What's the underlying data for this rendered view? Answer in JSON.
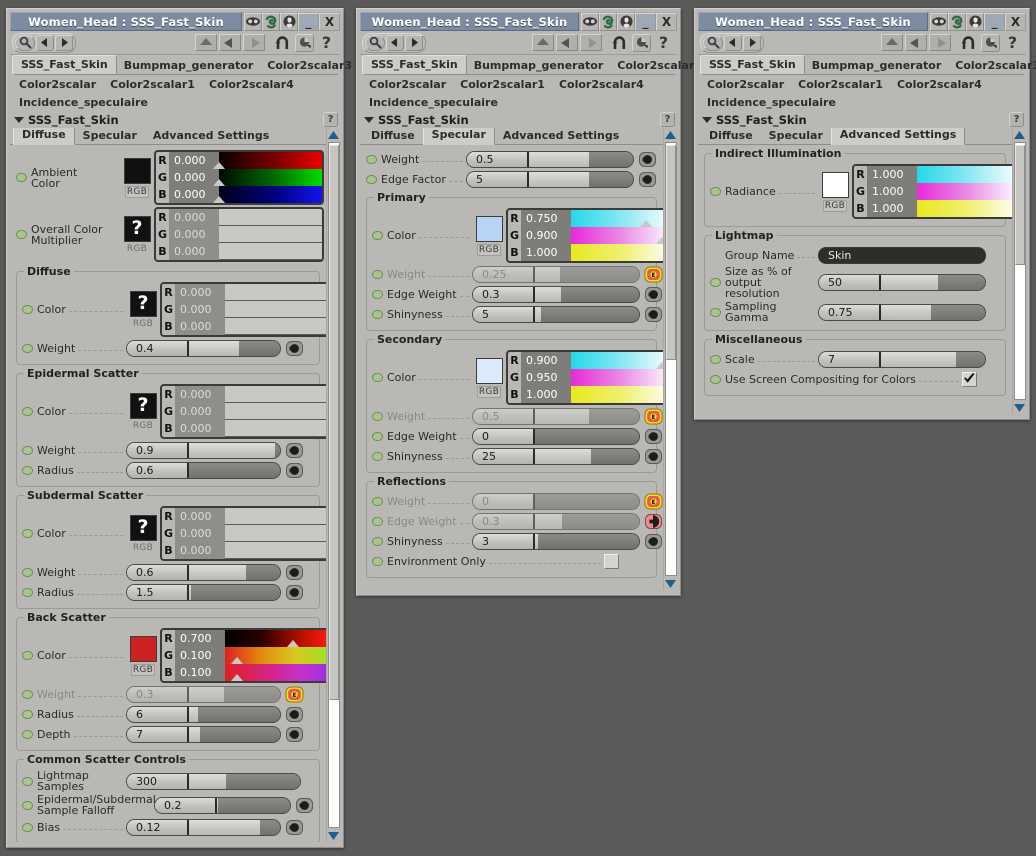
{
  "window": {
    "title": "Women_Head : SSS_Fast_Skin",
    "minimize_label": "_",
    "close_label": "X",
    "icons": [
      "goggles-icon",
      "spiral-icon",
      "face-icon"
    ],
    "toolbar": {
      "magnifier": "magnifier-icon",
      "prev": "prev-arrow-icon",
      "next": "next-arrow-icon",
      "nav_up": "nav-up-icon",
      "nav_left": "nav-left-icon",
      "nav_right": "nav-right-icon",
      "undo": "undo-arrow-icon",
      "render": "render-preview-icon",
      "help": "?"
    }
  },
  "node_tabs": {
    "row1": [
      "SSS_Fast_Skin",
      "Bumpmap_generator",
      "Color2scalar3"
    ],
    "row2": [
      "Color2scalar",
      "Color2scalar1",
      "Color2scalar4"
    ],
    "row3": [
      "Incidence_speculaire"
    ],
    "selected": "SSS_Fast_Skin"
  },
  "shader_header": {
    "title": "SSS_Fast_Skin",
    "help_label": "?"
  },
  "sub_tabs": [
    "Diffuse",
    "Specular",
    "Advanced Settings"
  ],
  "labels": {
    "rgb": "RGB",
    "r": "R",
    "g": "G",
    "b": "B",
    "question": "?"
  },
  "panel1": {
    "selected_tab": "Diffuse",
    "rows": [
      {
        "name": "ambient-color",
        "label_lines": [
          "Ambient",
          "Color"
        ],
        "type": "color",
        "swatch": "#101010",
        "swatch_kind": "solid",
        "rgb_active": true,
        "r": "0.000",
        "g": "0.000",
        "b": "0.000",
        "gradients": [
          "r-dark",
          "g-dark",
          "b-dark"
        ],
        "markers": [
          0,
          0,
          0
        ],
        "plug": "gray"
      },
      {
        "name": "overall-color-multiplier",
        "label_lines": [
          "Overall Color",
          "Multiplier"
        ],
        "type": "color",
        "swatch_kind": "question",
        "rgb_active": false,
        "r": "0.000",
        "g": "0.000",
        "b": "0.000",
        "gradients": [
          "flat",
          "flat",
          "flat"
        ],
        "plug": "red"
      }
    ],
    "groups": [
      {
        "name": "diffuse",
        "title": "Diffuse",
        "rows": [
          {
            "name": "diffuse-color",
            "label_lines": [
              "Color"
            ],
            "type": "color",
            "swatch_kind": "question",
            "rgb_active": false,
            "r": "0.000",
            "g": "0.000",
            "b": "0.000",
            "gradients": [
              "flat",
              "flat",
              "flat"
            ],
            "plug": "red"
          },
          {
            "name": "diffuse-weight",
            "label": "Weight",
            "type": "slider",
            "value": "0.4",
            "fill": 55,
            "plug": "gray"
          }
        ]
      },
      {
        "name": "epidermal-scatter",
        "title": "Epidermal Scatter",
        "rows": [
          {
            "name": "epidermal-color",
            "label_lines": [
              "Color"
            ],
            "type": "color",
            "swatch_kind": "question",
            "rgb_active": false,
            "r": "0.000",
            "g": "0.000",
            "b": "0.000",
            "gradients": [
              "flat",
              "flat",
              "flat"
            ],
            "plug": "red"
          },
          {
            "name": "epidermal-weight",
            "label": "Weight",
            "type": "slider",
            "value": "0.9",
            "fill": 94,
            "plug": "gray"
          },
          {
            "name": "epidermal-radius",
            "label": "Radius",
            "type": "slider",
            "value": "0.6",
            "fill": 0,
            "plug": "gray"
          }
        ]
      },
      {
        "name": "subdermal-scatter",
        "title": "Subdermal Scatter",
        "rows": [
          {
            "name": "subdermal-color",
            "label_lines": [
              "Color"
            ],
            "type": "color",
            "swatch_kind": "question",
            "rgb_active": false,
            "r": "0.000",
            "g": "0.000",
            "b": "0.000",
            "gradients": [
              "flat",
              "flat",
              "flat"
            ],
            "plug": "red"
          },
          {
            "name": "subdermal-weight",
            "label": "Weight",
            "type": "slider",
            "value": "0.6",
            "fill": 63,
            "plug": "gray"
          },
          {
            "name": "subdermal-radius",
            "label": "Radius",
            "type": "slider",
            "value": "1.5",
            "fill": 2,
            "plug": "gray"
          }
        ]
      },
      {
        "name": "back-scatter",
        "title": "Back Scatter",
        "rows": [
          {
            "name": "backscatter-color",
            "label_lines": [
              "Color"
            ],
            "type": "color",
            "swatch": "#cc2222",
            "swatch_kind": "solid",
            "rgb_active": true,
            "r": "0.700",
            "g": "0.100",
            "b": "0.100",
            "gradients": [
              "r-hot",
              "g-hot",
              "b-hot"
            ],
            "markers": [
              66,
              12,
              12
            ],
            "plug": "gray"
          },
          {
            "name": "backscatter-weight",
            "label": "Weight",
            "type": "slider",
            "value": "0.3",
            "fill": 38,
            "disabled": true,
            "plug": "yellow"
          },
          {
            "name": "backscatter-radius",
            "label": "Radius",
            "type": "slider",
            "value": "6",
            "fill": 10,
            "plug": "gray"
          },
          {
            "name": "backscatter-depth",
            "label": "Depth",
            "type": "slider",
            "value": "7",
            "fill": 12,
            "plug": "gray"
          }
        ]
      },
      {
        "name": "common-scatter-controls",
        "title": "Common Scatter Controls",
        "rows": [
          {
            "name": "lightmap-samples",
            "label_lines": [
              "Lightmap",
              "Samples"
            ],
            "type": "slider",
            "value": "300",
            "fill": 33,
            "wide": true
          },
          {
            "name": "epidermal-subdermal-sample-falloff",
            "label_lines": [
              "Epidermal/Subdermal",
              "Sample Falloff"
            ],
            "type": "slider",
            "value": "0.2",
            "fill": 2,
            "plug": "gray",
            "narrow": true
          },
          {
            "name": "bias",
            "label": "Bias",
            "type": "slider",
            "value": "0.12",
            "fill": 78,
            "plug": "gray"
          }
        ]
      }
    ]
  },
  "panel2": {
    "selected_tab": "Specular",
    "rows": [
      {
        "name": "specular-weight",
        "label": "Weight",
        "type": "slider",
        "value": "0.5",
        "fill": 58,
        "plug": "gray"
      },
      {
        "name": "specular-edge-factor",
        "label": "Edge Factor",
        "type": "slider",
        "value": "5",
        "fill": 58,
        "plug": "gray"
      }
    ],
    "groups": [
      {
        "name": "primary",
        "title": "Primary",
        "rows": [
          {
            "name": "primary-color",
            "label_lines": [
              "Color"
            ],
            "type": "color",
            "swatch": "#b8d4f5",
            "swatch_kind": "solid",
            "rgb_active": true,
            "r": "0.750",
            "g": "0.900",
            "b": "1.000",
            "gradients": [
              "r-cyan",
              "g-magenta",
              "b-yellow"
            ],
            "markers": [
              73,
              88,
              100
            ],
            "plug": "gray"
          },
          {
            "name": "primary-weight",
            "label": "Weight",
            "type": "slider",
            "value": "0.25",
            "fill": 24,
            "disabled": true,
            "plug": "yellow"
          },
          {
            "name": "primary-edge-weight",
            "label": "Edge Weight",
            "type": "slider",
            "value": "0.3",
            "fill": 25,
            "plug": "gray"
          },
          {
            "name": "primary-shinyness",
            "label": "Shinyness",
            "type": "slider",
            "value": "5",
            "fill": 6,
            "plug": "gray"
          }
        ]
      },
      {
        "name": "secondary",
        "title": "Secondary",
        "rows": [
          {
            "name": "secondary-color",
            "label_lines": [
              "Color"
            ],
            "type": "color",
            "swatch": "#dceafb",
            "swatch_kind": "solid",
            "rgb_active": true,
            "r": "0.900",
            "g": "0.950",
            "b": "1.000",
            "gradients": [
              "r-cyan",
              "g-magenta",
              "b-yellow"
            ],
            "markers": [
              88,
              94,
              100
            ],
            "plug": "gray"
          },
          {
            "name": "secondary-weight",
            "label": "Weight",
            "type": "slider",
            "value": "0.5",
            "fill": 52,
            "disabled": true,
            "plug": "yellow"
          },
          {
            "name": "secondary-edge-weight",
            "label": "Edge Weight",
            "type": "slider",
            "value": "0",
            "fill": 0,
            "plug": "gray"
          },
          {
            "name": "secondary-shinyness",
            "label": "Shinyness",
            "type": "slider",
            "value": "25",
            "fill": 54,
            "plug": "gray"
          }
        ]
      },
      {
        "name": "reflections",
        "title": "Reflections",
        "rows": [
          {
            "name": "reflections-weight",
            "label": "Weight",
            "type": "slider",
            "value": "0",
            "fill": 0,
            "disabled": true,
            "plug": "yellow"
          },
          {
            "name": "reflections-edge-weight",
            "label": "Edge Weight",
            "type": "slider",
            "value": "0.3",
            "fill": 26,
            "disabled": true,
            "plug": "red"
          },
          {
            "name": "reflections-shinyness",
            "label": "Shinyness",
            "type": "slider",
            "value": "3",
            "fill": 3,
            "plug": "gray"
          },
          {
            "name": "environment-only",
            "label": "Environment Only",
            "type": "checkbox",
            "checked": false
          }
        ]
      }
    ]
  },
  "panel3": {
    "selected_tab": "Advanced Settings",
    "groups": [
      {
        "name": "indirect-illumination",
        "title": "Indirect Illumination",
        "rows": [
          {
            "name": "radiance",
            "label_lines": [
              "Radiance"
            ],
            "type": "color",
            "swatch": "#ffffff",
            "swatch_kind": "solid",
            "rgb_active": true,
            "r": "1.000",
            "g": "1.000",
            "b": "1.000",
            "gradients": [
              "r-cyan",
              "g-magenta",
              "b-yellow"
            ],
            "markers": [
              100,
              100,
              100
            ],
            "plug": "gray"
          }
        ]
      },
      {
        "name": "lightmap",
        "title": "Lightmap",
        "rows": [
          {
            "name": "group-name",
            "label": "Group Name",
            "type": "text",
            "value": "Skin"
          },
          {
            "name": "size-as-percent-of-output-resolution",
            "label_lines": [
              "Size as % of",
              "output",
              "resolution"
            ],
            "type": "slider",
            "value": "50",
            "fill": 55,
            "noled": false
          },
          {
            "name": "sampling-gamma",
            "label_lines": [
              "Sampling",
              "Gamma"
            ],
            "type": "slider",
            "value": "0.75",
            "fill": 48
          }
        ]
      },
      {
        "name": "miscellaneous",
        "title": "Miscellaneous",
        "rows": [
          {
            "name": "scale",
            "label": "Scale",
            "type": "slider",
            "value": "7",
            "fill": 72
          },
          {
            "name": "use-screen-compositing-for-colors",
            "label": "Use Screen Compositing for Colors",
            "type": "checkbox",
            "checked": true
          }
        ]
      }
    ]
  }
}
